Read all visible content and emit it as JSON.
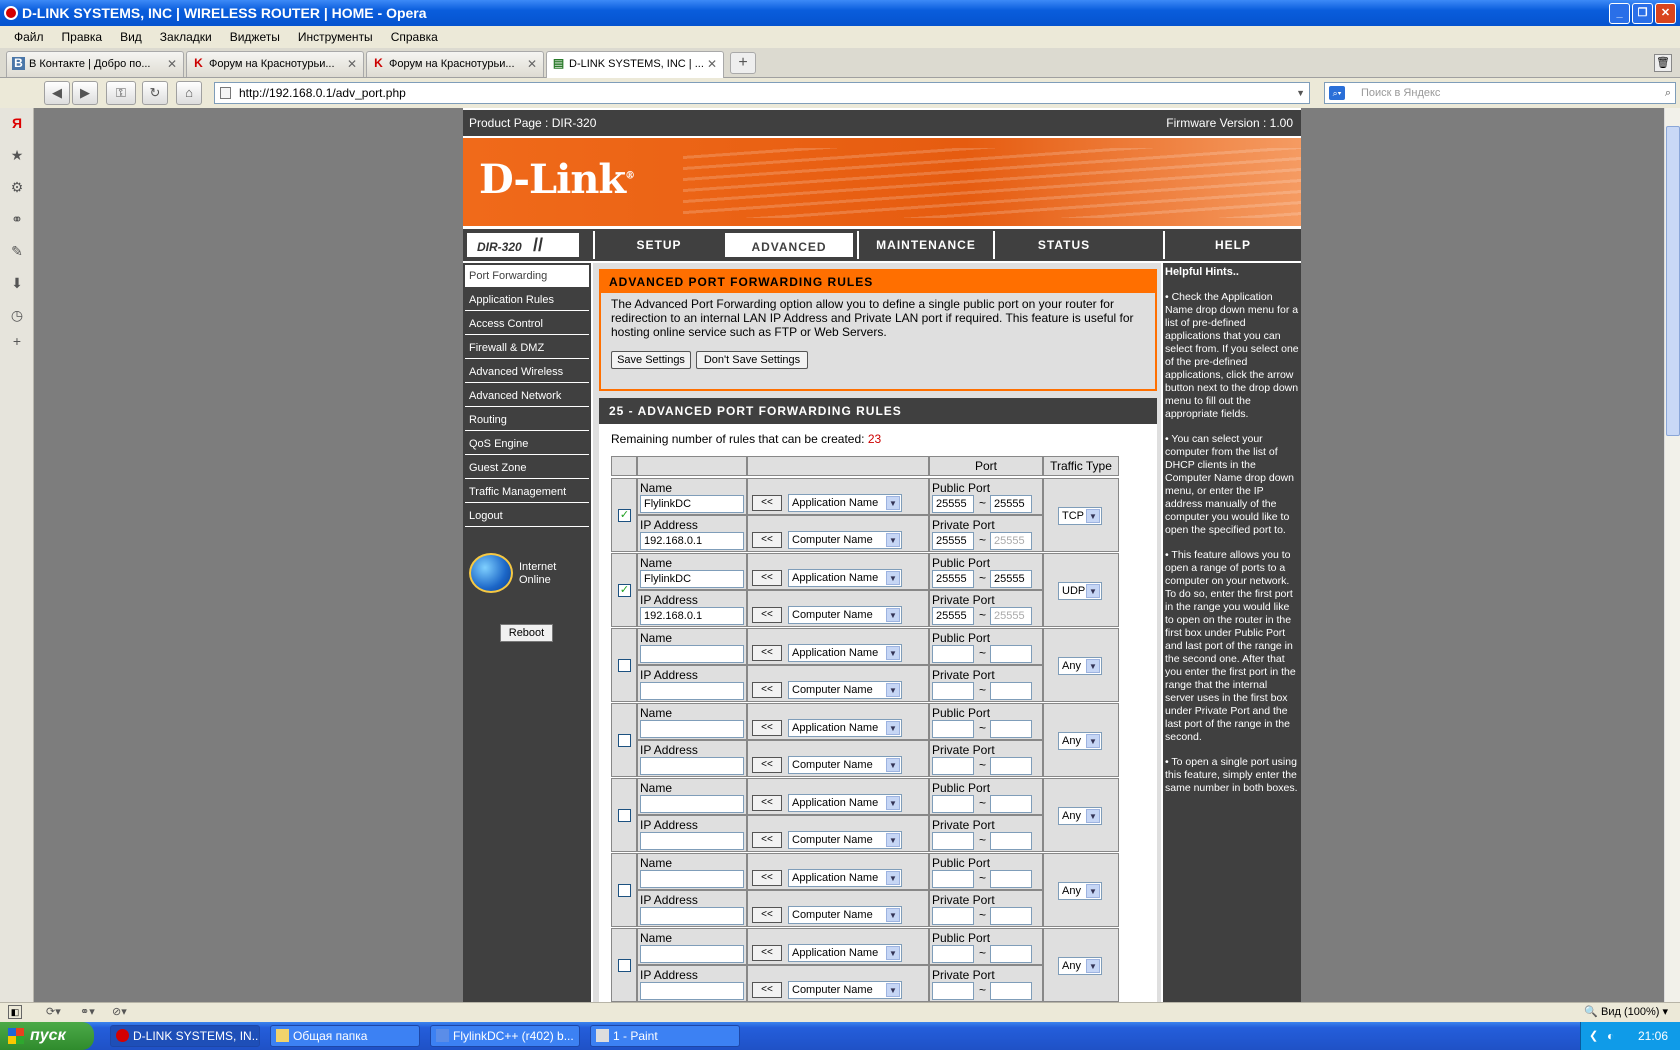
{
  "window": {
    "title": "D-LINK SYSTEMS, INC | WIRELESS ROUTER | HOME - Opera"
  },
  "menu": [
    "Файл",
    "Правка",
    "Вид",
    "Закладки",
    "Виджеты",
    "Инструменты",
    "Справка"
  ],
  "tabs": [
    {
      "label": "В Контакте | Добро по...",
      "icon": "В"
    },
    {
      "label": "Форум на Краснотурьи...",
      "icon": "K"
    },
    {
      "label": "Форум на Краснотурьи...",
      "icon": "K"
    },
    {
      "label": "D-LINK SYSTEMS, INC | ...",
      "icon": "▤"
    }
  ],
  "address": {
    "url": "http://192.168.0.1/adv_port.php"
  },
  "search": {
    "placeholder": "Поиск в Яндекс"
  },
  "router": {
    "product_page": "Product Page :  DIR-320",
    "firmware": "Firmware Version : 1.00",
    "logo": "D-Link",
    "model": "DIR-320",
    "nav_tabs": [
      "SETUP",
      "ADVANCED",
      "MAINTENANCE",
      "STATUS",
      "HELP"
    ],
    "active_tab": "ADVANCED",
    "left_menu": [
      "Port Forwarding",
      "Application Rules",
      "Access Control",
      "Firewall & DMZ",
      "Advanced Wireless",
      "Advanced Network",
      "Routing",
      "QoS Engine",
      "Guest Zone",
      "Traffic Management",
      "Logout"
    ],
    "internet_status": {
      "line1": "Internet",
      "line2": "Online"
    },
    "reboot_label": "Reboot",
    "section1": {
      "title": "ADVANCED PORT FORWARDING RULES",
      "description": "The Advanced Port Forwarding option allow you to define a single public port on your router for redirection to an internal LAN IP Address and Private LAN port if required. This feature is useful for hosting online service such as FTP or Web Servers.",
      "save_label": "Save Settings",
      "dont_save_label": "Don't Save Settings"
    },
    "section2": {
      "title": "25 - ADVANCED PORT FORWARDING RULES",
      "remaining_label": "Remaining number of rules that can be created:",
      "remaining_count": "23",
      "headers": {
        "port": "Port",
        "traffic": "Traffic Type"
      },
      "labels": {
        "name": "Name",
        "ip": "IP Address",
        "public_port": "Public Port",
        "private_port": "Private Port",
        "copy_btn": "<<",
        "app_name": "Application Name",
        "computer_name": "Computer Name",
        "tilde": "~"
      },
      "rules": [
        {
          "checked": true,
          "name": "FlylinkDC",
          "ip": "192.168.0.1",
          "pub_start": "25555",
          "pub_end": "25555",
          "priv_start": "25555",
          "priv_end": "25555",
          "traffic": "TCP"
        },
        {
          "checked": true,
          "name": "FlylinkDC",
          "ip": "192.168.0.1",
          "pub_start": "25555",
          "pub_end": "25555",
          "priv_start": "25555",
          "priv_end": "25555",
          "traffic": "UDP"
        },
        {
          "checked": false,
          "name": "",
          "ip": "",
          "pub_start": "",
          "pub_end": "",
          "priv_start": "",
          "priv_end": "",
          "traffic": "Any"
        },
        {
          "checked": false,
          "name": "",
          "ip": "",
          "pub_start": "",
          "pub_end": "",
          "priv_start": "",
          "priv_end": "",
          "traffic": "Any"
        },
        {
          "checked": false,
          "name": "",
          "ip": "",
          "pub_start": "",
          "pub_end": "",
          "priv_start": "",
          "priv_end": "",
          "traffic": "Any"
        },
        {
          "checked": false,
          "name": "",
          "ip": "",
          "pub_start": "",
          "pub_end": "",
          "priv_start": "",
          "priv_end": "",
          "traffic": "Any"
        },
        {
          "checked": false,
          "name": "",
          "ip": "",
          "pub_start": "",
          "pub_end": "",
          "priv_start": "",
          "priv_end": "",
          "traffic": "Any"
        }
      ]
    },
    "hints": {
      "title": "Helpful Hints..",
      "items": [
        "• Check the Application Name drop down menu for a list of pre-defined applications that you can select from. If you select one of the pre-defined applications, click the arrow button next to the drop down menu to fill out the appropriate fields.",
        "• You can select your computer from the list of DHCP clients in the Computer Name drop down menu, or enter the IP address manually of the computer you would like to open the specified port to.",
        "• This feature allows you to open a range of ports to a computer on your network. To do so, enter the first port in the range you would like to open on the router in the first box under Public Port and last port of the range in the second one. After that you enter the first port in the range that the internal server uses in the first box under Private Port and the last port of the range in the second.",
        "• To open a single port using this feature, simply enter the same number in both boxes."
      ]
    }
  },
  "statusbar": {
    "zoom": "Вид (100%)"
  },
  "taskbar": {
    "start": "пуск",
    "items": [
      "D-LINK SYSTEMS, IN...",
      "Общая папка",
      "FlylinkDC++ (r402) b...",
      "1 - Paint"
    ],
    "clock": "21:06"
  },
  "colors": {
    "accent_orange": "#ff6f00",
    "dark_gray": "#404040",
    "xp_blue": "#245edb"
  }
}
